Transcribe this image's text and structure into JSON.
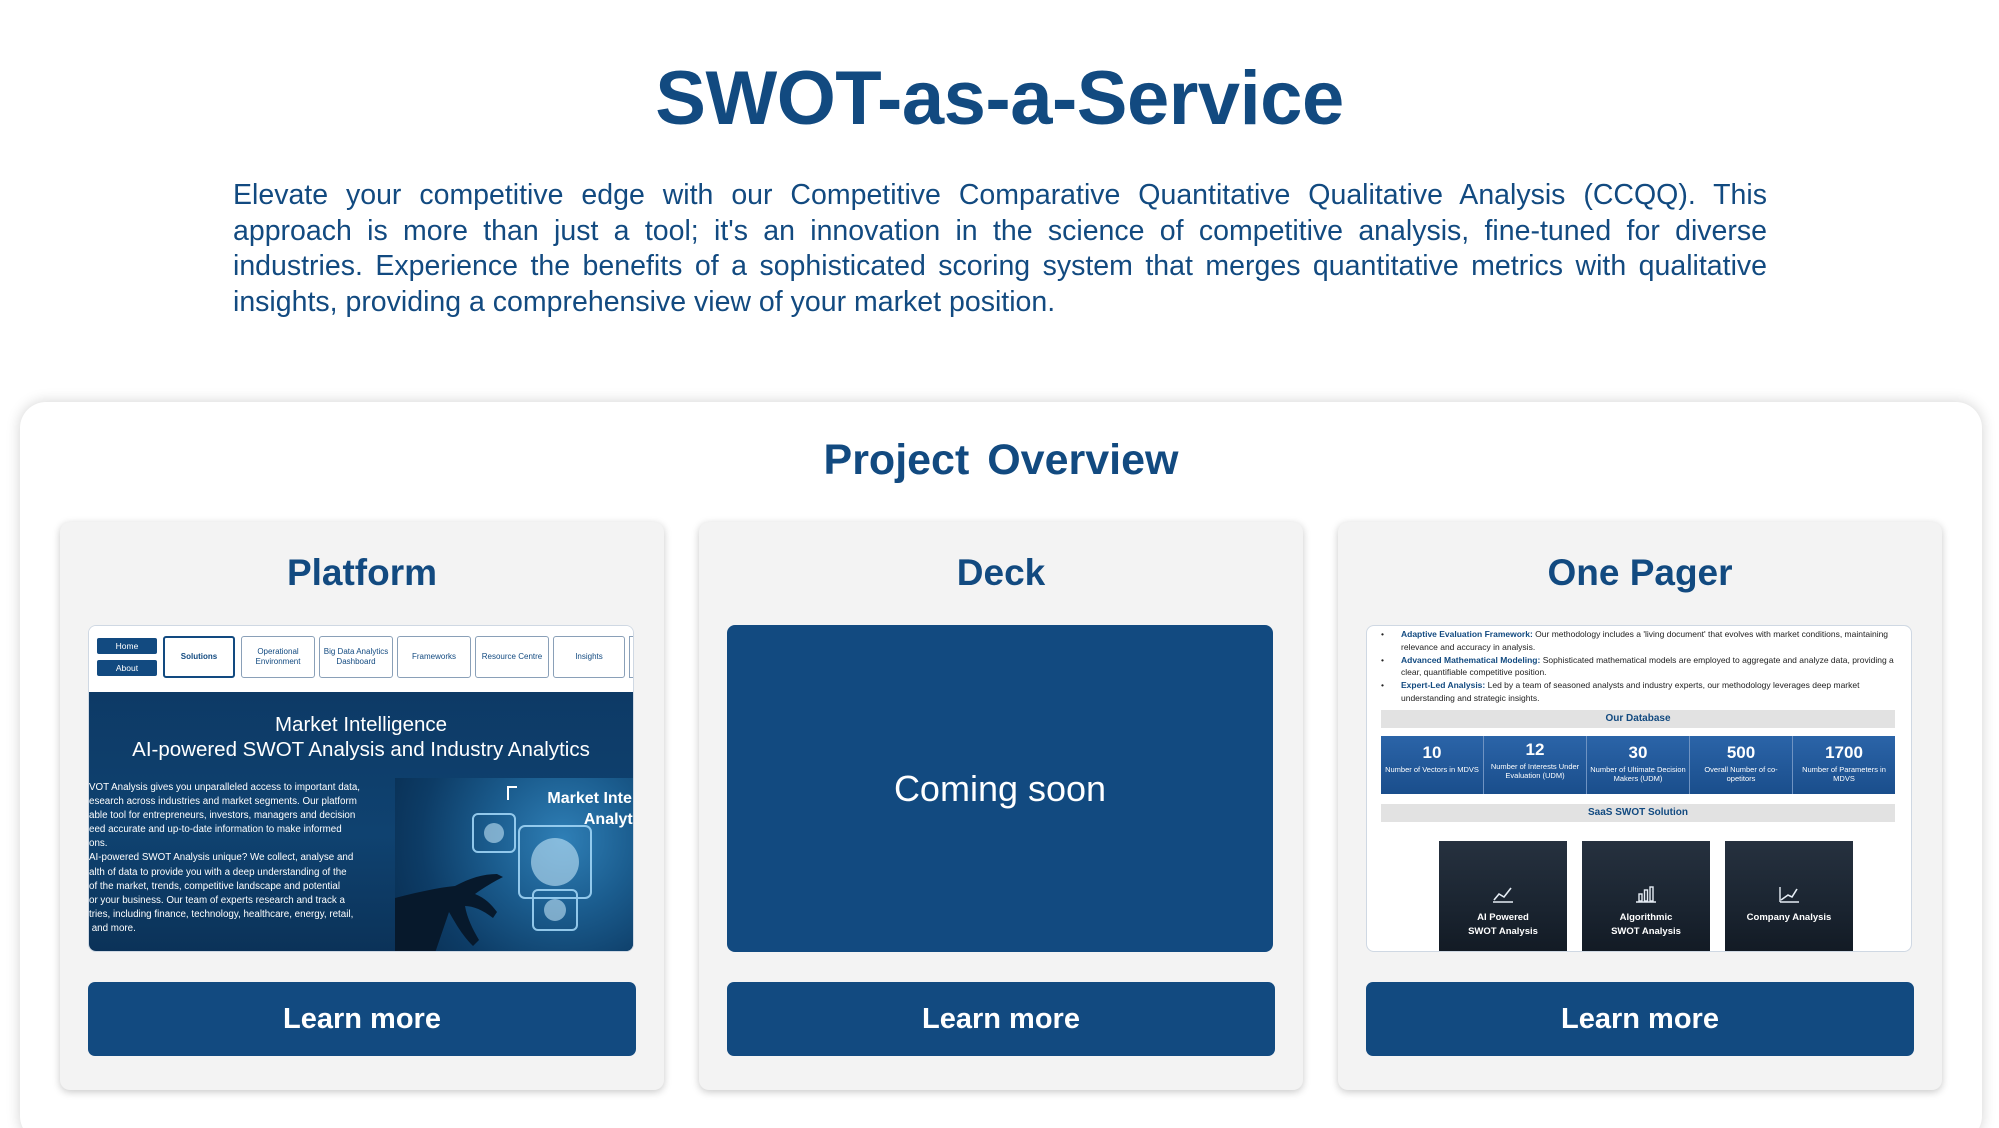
{
  "hero": {
    "title": "SWOT-as-a-Service",
    "description": "Elevate your competitive edge with our Competitive Comparative Quantitative Qualitative Analysis (CCQQ). This approach is more than just a tool; it's an innovation in the science of competitive analysis, fine-tuned for diverse industries. Experience the benefits of a sophisticated scoring system that merges quantitative metrics with qualitative insights, providing a comprehensive view of your market position."
  },
  "overview": {
    "title": "Project  Overview",
    "cards": [
      {
        "title": "Platform",
        "button": "Learn more"
      },
      {
        "title": "Deck",
        "button": "Learn more"
      },
      {
        "title": "One Pager",
        "button": "Learn more"
      }
    ]
  },
  "platform_preview": {
    "side_buttons": [
      "Home",
      "About"
    ],
    "tabs": [
      "Solutions",
      "Operational Environment",
      "Big Data Analytics Dashboard",
      "Frameworks",
      "Resource Centre",
      "Insights"
    ],
    "heading_line1": "Market Intelligence",
    "heading_line2": "AI-powered SWOT Analysis and Industry Analytics",
    "body": "VOT Analysis gives you unparalleled access to important data,\nesearch across industries and market segments. Our platform\nable tool for entrepreneurs, investors, managers and decision\need accurate and up-to-date information to make informed\nons.\nAI-powered SWOT Analysis unique? We collect, analyse and\nalth of data to provide you with a deep understanding of the\nof the market, trends, competitive landscape and potential\nor your business. Our team of experts research and track a\ntries, including finance, technology, healthcare, energy, retail,\n and more.",
    "image_caption": "Market Intellig\nAnalytics"
  },
  "deck_preview": {
    "text": "Coming soon"
  },
  "onepager_preview": {
    "bullets": [
      {
        "lead": "Adaptive Evaluation Framework:",
        "text": " Our methodology includes a 'living document' that evolves with market conditions, maintaining relevance and accuracy in analysis."
      },
      {
        "lead": "Advanced Mathematical Modeling:",
        "text": " Sophisticated mathematical models are employed to aggregate and analyze data, providing a clear, quantifiable competitive position."
      },
      {
        "lead": "Expert-Led Analysis:",
        "text": " Led by a team of seasoned analysts and industry experts, our methodology leverages deep market understanding and strategic insights."
      }
    ],
    "database_heading": "Our Database",
    "stats": [
      {
        "value": "10",
        "label": "Number of Vectors in MDVS"
      },
      {
        "value": "12",
        "label": "Number of Interests Under Evaluation (UDM)"
      },
      {
        "value": "30",
        "label": "Number of Ultimate Decision Makers (UDM)"
      },
      {
        "value": "500",
        "label": "Overall Number of co-opetitors"
      },
      {
        "value": "1700",
        "label": "Number of Parameters in MDVS"
      }
    ],
    "solution_heading": "SaaS SWOT Solution",
    "tiles": [
      {
        "line1": "AI Powered",
        "line2": "SWOT Analysis",
        "icon": "line-chart-icon"
      },
      {
        "line1": "Algorithmic",
        "line2": "SWOT Analysis",
        "icon": "bar-chart-icon"
      },
      {
        "line1": "Company Analysis",
        "line2": "",
        "icon": "trend-chart-icon"
      }
    ]
  }
}
